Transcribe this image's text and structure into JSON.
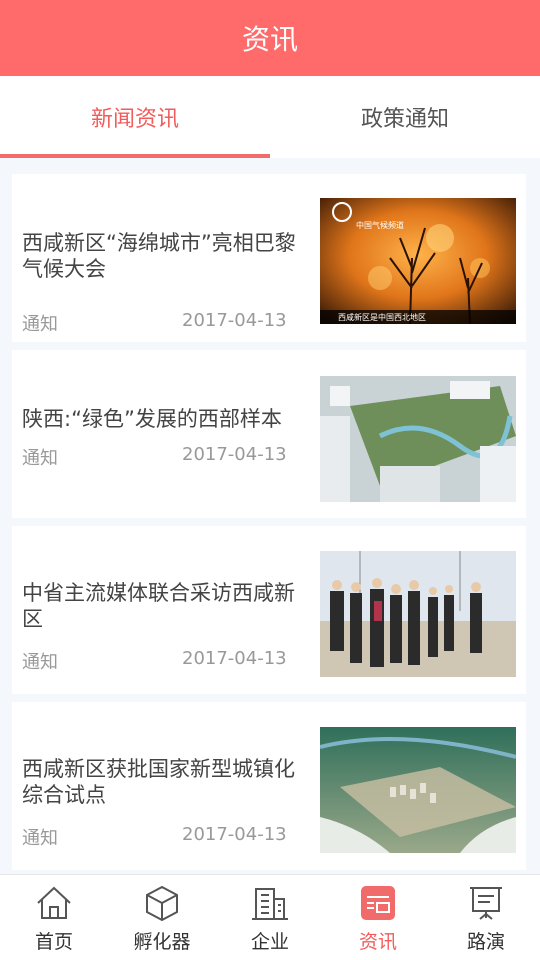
{
  "header": {
    "title": "资讯"
  },
  "tabs": [
    {
      "label": "新闻资讯",
      "active": true
    },
    {
      "label": "政策通知",
      "active": false
    }
  ],
  "news": [
    {
      "title": "西咸新区“海绵城市”亮相巴黎气候大会",
      "tag": "通知",
      "date": "2017-04-13",
      "image_caption": "西咸新区是中国西北地区",
      "image_logo": "中国气候频道"
    },
    {
      "title": "陕西:“绿色”发展的西部样本",
      "tag": "通知",
      "date": "2017-04-13"
    },
    {
      "title": "中省主流媒体联合采访西咸新区",
      "tag": "通知",
      "date": "2017-04-13"
    },
    {
      "title": "西咸新区获批国家新型城镇化综合试点",
      "tag": "通知",
      "date": "2017-04-13"
    }
  ],
  "bottom_nav": [
    {
      "label": "首页",
      "icon": "home-icon",
      "active": false
    },
    {
      "label": "孵化器",
      "icon": "cube-icon",
      "active": false
    },
    {
      "label": "企业",
      "icon": "building-icon",
      "active": false
    },
    {
      "label": "资讯",
      "icon": "news-icon",
      "active": true
    },
    {
      "label": "路演",
      "icon": "presentation-icon",
      "active": false
    }
  ],
  "colors": {
    "accent": "#ff6b6b",
    "active_text": "#f25c5c",
    "muted": "#999999"
  }
}
